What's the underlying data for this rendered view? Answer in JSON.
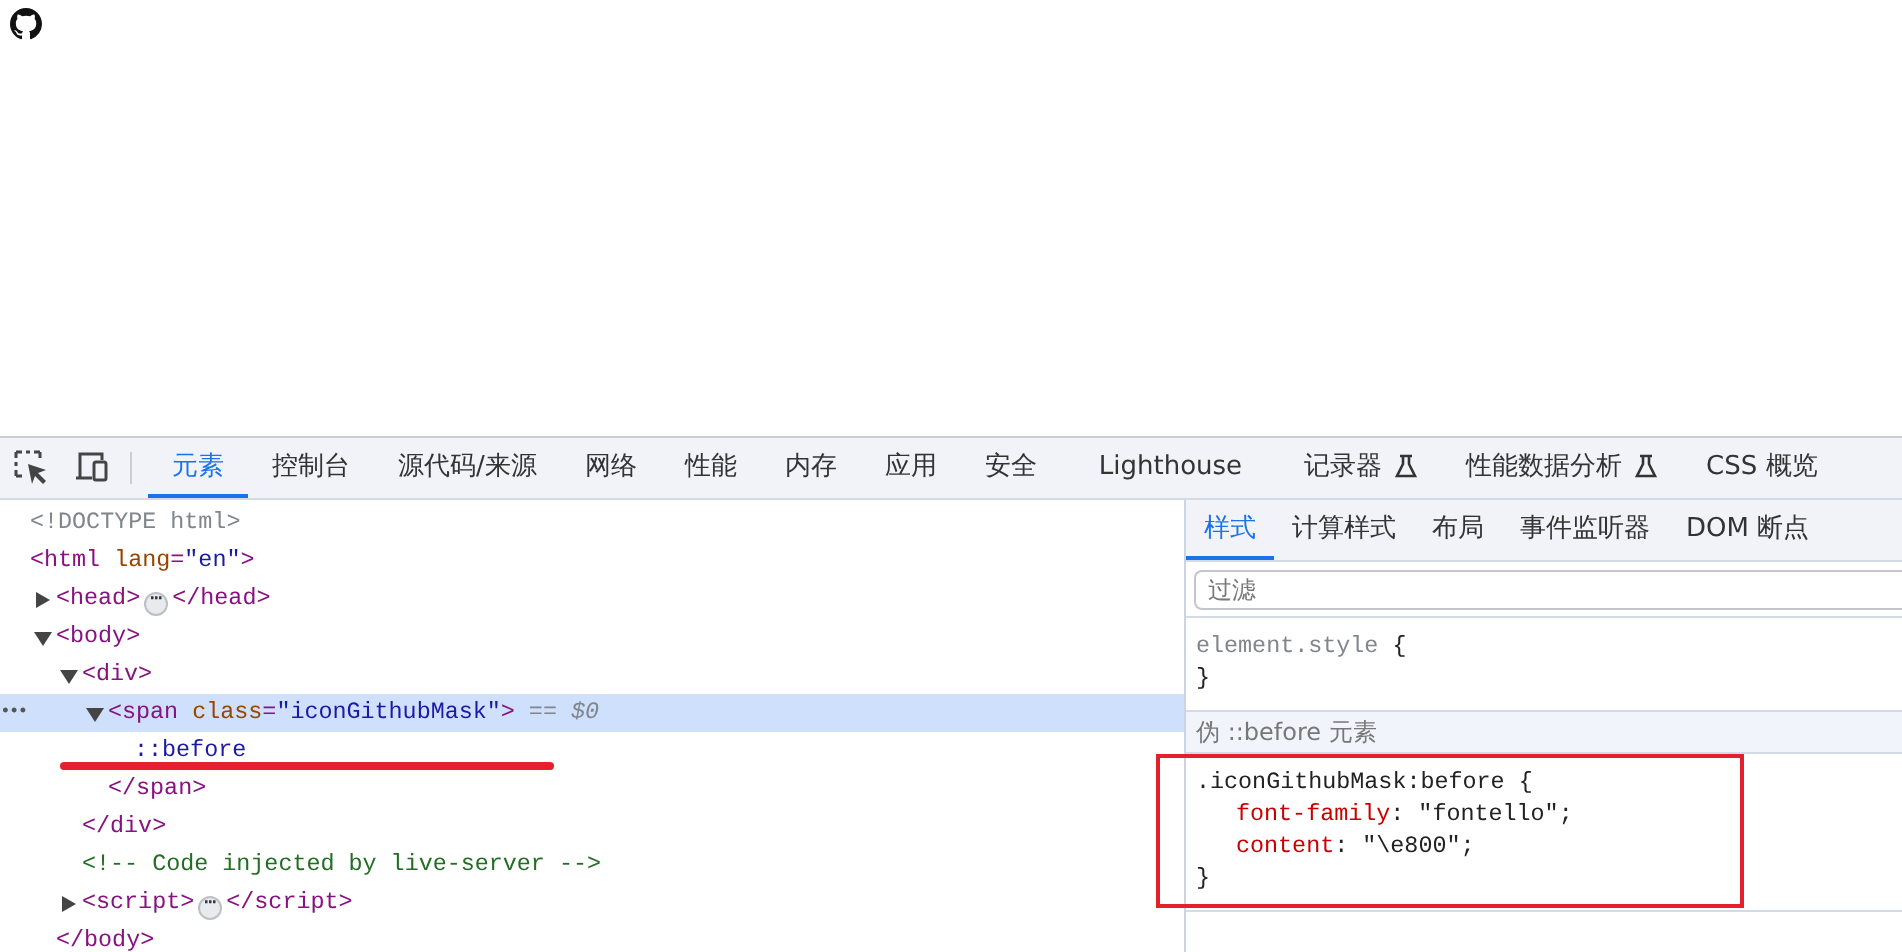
{
  "page": {
    "logo": {
      "kind": "icon"
    }
  },
  "devtools": {
    "tabs": [
      {
        "label": "元素",
        "selected": true,
        "experimental": false
      },
      {
        "label": "控制台",
        "selected": false,
        "experimental": false
      },
      {
        "label": "源代码/来源",
        "selected": false,
        "experimental": false
      },
      {
        "label": "网络",
        "selected": false,
        "experimental": false
      },
      {
        "label": "性能",
        "selected": false,
        "experimental": false
      },
      {
        "label": "内存",
        "selected": false,
        "experimental": false
      },
      {
        "label": "应用",
        "selected": false,
        "experimental": false
      },
      {
        "label": "安全",
        "selected": false,
        "experimental": false
      },
      {
        "label": "Lighthouse",
        "selected": false,
        "experimental": false
      },
      {
        "label": "记录器",
        "selected": false,
        "experimental": true
      },
      {
        "label": "性能数据分析",
        "selected": false,
        "experimental": true
      },
      {
        "label": "CSS 概览",
        "selected": false,
        "experimental": false
      }
    ],
    "dom": {
      "nodes": [
        {
          "selected": false,
          "tokens": [
            {
              "kind": "doctype",
              "text": "<!DOCTYPE html>"
            }
          ]
        },
        {
          "selected": false,
          "tokens": [
            {
              "kind": "tag",
              "text": "<html"
            },
            {
              "kind": "attr",
              "text": " lang"
            },
            {
              "kind": "tag",
              "text": "="
            },
            {
              "kind": "value",
              "text": "\"en\""
            },
            {
              "kind": "tag",
              "text": ">"
            }
          ],
          "children": [
            {
              "selected": false,
              "expanded": false,
              "tokens": [
                {
                  "kind": "tag",
                  "text": "<head>"
                },
                {
                  "kind": "ellipsis",
                  "text": "⋯"
                },
                {
                  "kind": "tag",
                  "text": "</head>"
                }
              ]
            },
            {
              "selected": false,
              "expanded": true,
              "tokens": [
                {
                  "kind": "tag",
                  "text": "<body>"
                }
              ],
              "close": [
                {
                  "kind": "tag",
                  "text": "</body>"
                }
              ],
              "children": [
                {
                  "selected": false,
                  "expanded": true,
                  "tokens": [
                    {
                      "kind": "tag",
                      "text": "<div>"
                    }
                  ],
                  "close": [
                    {
                      "kind": "tag",
                      "text": "</div>"
                    }
                  ],
                  "children": [
                    {
                      "selected": true,
                      "expanded": true,
                      "row_menu": "•••",
                      "tokens": [
                        {
                          "kind": "tag",
                          "text": "<span"
                        },
                        {
                          "kind": "attr",
                          "text": " class"
                        },
                        {
                          "kind": "tag",
                          "text": "="
                        },
                        {
                          "kind": "value",
                          "text": "\"iconGithubMask\""
                        },
                        {
                          "kind": "tag",
                          "text": ">"
                        },
                        {
                          "kind": "muted",
                          "text": " == $0"
                        }
                      ],
                      "close": [
                        {
                          "kind": "tag",
                          "text": "</span>"
                        }
                      ],
                      "children": [
                        {
                          "selected": false,
                          "underlined": true,
                          "tokens": [
                            {
                              "kind": "pseudo",
                              "text": "::before"
                            }
                          ]
                        }
                      ]
                    }
                  ]
                },
                {
                  "selected": false,
                  "tokens": [
                    {
                      "kind": "comment",
                      "text": "<!-- Code injected by live-server -->"
                    }
                  ]
                },
                {
                  "selected": false,
                  "expanded": false,
                  "tokens": [
                    {
                      "kind": "tag",
                      "text": "<script>"
                    },
                    {
                      "kind": "ellipsis",
                      "text": "⋯"
                    },
                    {
                      "kind": "tag",
                      "text": "</script>"
                    }
                  ]
                }
              ]
            }
          ]
        }
      ]
    },
    "styles": {
      "tabs": [
        {
          "label": "样式",
          "selected": true
        },
        {
          "label": "计算样式",
          "selected": false
        },
        {
          "label": "布局",
          "selected": false
        },
        {
          "label": "事件监听器",
          "selected": false
        },
        {
          "label": "DOM 断点",
          "selected": false
        }
      ],
      "filter": {
        "placeholder": "过滤"
      },
      "blocks": [
        {
          "kind": "rule",
          "selector": "element.style",
          "muted": true,
          "highlighted": false,
          "open": " {",
          "close": "}"
        },
        {
          "kind": "header",
          "title": "伪 ::before 元素"
        },
        {
          "kind": "rule",
          "selector": ".iconGithubMask:before",
          "muted": false,
          "highlighted": true,
          "open": " {",
          "close": "}",
          "properties": [
            {
              "name": "font-family",
              "rest": ": \"fontello\";"
            },
            {
              "name": "content",
              "rest": ": \"\\e800\";"
            }
          ]
        }
      ]
    }
  }
}
